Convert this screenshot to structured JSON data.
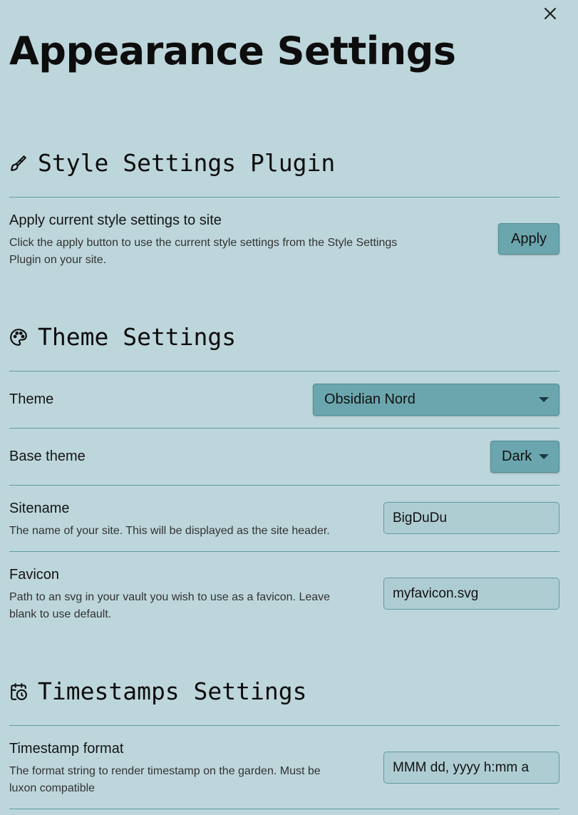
{
  "page": {
    "title": "Appearance Settings"
  },
  "sections": {
    "style": {
      "heading": "Style Settings Plugin",
      "icon": "paintbrush-icon",
      "apply": {
        "name": "Apply current style settings to site",
        "desc_line1": "Click the apply button to use the current style settings from the Style Settings",
        "desc_line2": "Plugin on your site.",
        "button_label": "Apply"
      }
    },
    "theme": {
      "heading": "Theme Settings",
      "icon": "palette-icon",
      "theme": {
        "name": "Theme",
        "value": "Obsidian Nord"
      },
      "base_theme": {
        "name": "Base theme",
        "value": "Dark"
      },
      "sitename": {
        "name": "Sitename",
        "desc": "The name of your site. This will be displayed as the site header.",
        "value": "BigDuDu"
      },
      "favicon": {
        "name": "Favicon",
        "desc_line1": "Path to an svg in your vault you wish to use as a favicon. Leave",
        "desc_line2": "blank to use default.",
        "value": "myfavicon.svg"
      }
    },
    "timestamps": {
      "heading": "Timestamps Settings",
      "icon": "calendar-clock-icon",
      "format": {
        "name": "Timestamp format",
        "desc_line1": "The format string to render timestamp on the garden. Must be",
        "desc_line2": "luxon compatible",
        "value": "MMM dd, yyyy h:mm a"
      }
    }
  },
  "colors": {
    "background": "#bdd6db",
    "accent": "#6ba6ae",
    "divider": "#5f9aa2",
    "input_bg": "#aecdd3"
  }
}
